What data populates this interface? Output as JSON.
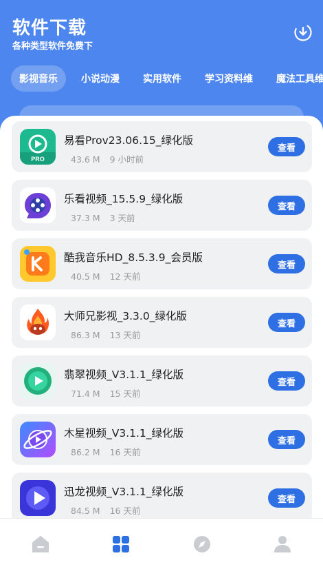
{
  "header": {
    "title": "软件下载",
    "subtitle": "各种类型软件免费下"
  },
  "category_tabs": [
    {
      "label": "影视音乐",
      "active": true
    },
    {
      "label": "小说动漫",
      "active": false
    },
    {
      "label": "实用软件",
      "active": false
    },
    {
      "label": "学习资料维",
      "active": false
    },
    {
      "label": "魔法工具维",
      "active": false
    }
  ],
  "apps": [
    {
      "name": "易看Prov23.06.15_绿化版",
      "size": "43.6 M",
      "time": "9 小时前",
      "button": "查看",
      "icon": "play-pro-icon"
    },
    {
      "name": "乐看视频_15.5.9_绿化版",
      "size": "37.3 M",
      "time": "3 天前",
      "button": "查看",
      "icon": "film-reel-icon"
    },
    {
      "name": "酷我音乐HD_8.5.3.9_会员版",
      "size": "40.5 M",
      "time": "12 天前",
      "button": "查看",
      "icon": "kuwo-music-icon"
    },
    {
      "name": "大师兄影视_3.3.0_绿化版",
      "size": "86.3 M",
      "time": "13 天前",
      "button": "查看",
      "icon": "fire-monkey-icon"
    },
    {
      "name": "翡翠视频_V3.1.1_绿化版",
      "size": "71.4 M",
      "time": "15 天前",
      "button": "查看",
      "icon": "play-circle-icon"
    },
    {
      "name": "木星视频_V3.1.1_绿化版",
      "size": "86.2 M",
      "time": "16 天前",
      "button": "查看",
      "icon": "planet-icon"
    },
    {
      "name": "迅龙视频_V3.1.1_绿化版",
      "size": "84.5 M",
      "time": "16 天前",
      "button": "查看",
      "icon": "play-triangle-icon"
    }
  ],
  "bottom_nav": [
    {
      "icon": "home-icon",
      "active": false
    },
    {
      "icon": "apps-grid-icon",
      "active": true
    },
    {
      "icon": "compass-icon",
      "active": false
    },
    {
      "icon": "user-icon",
      "active": false
    }
  ],
  "colors": {
    "header_bg": "#4d86ee",
    "button_bg": "#2f6fe4",
    "active_nav": "#2f6fe4",
    "inactive_nav": "#c9ccd1"
  }
}
